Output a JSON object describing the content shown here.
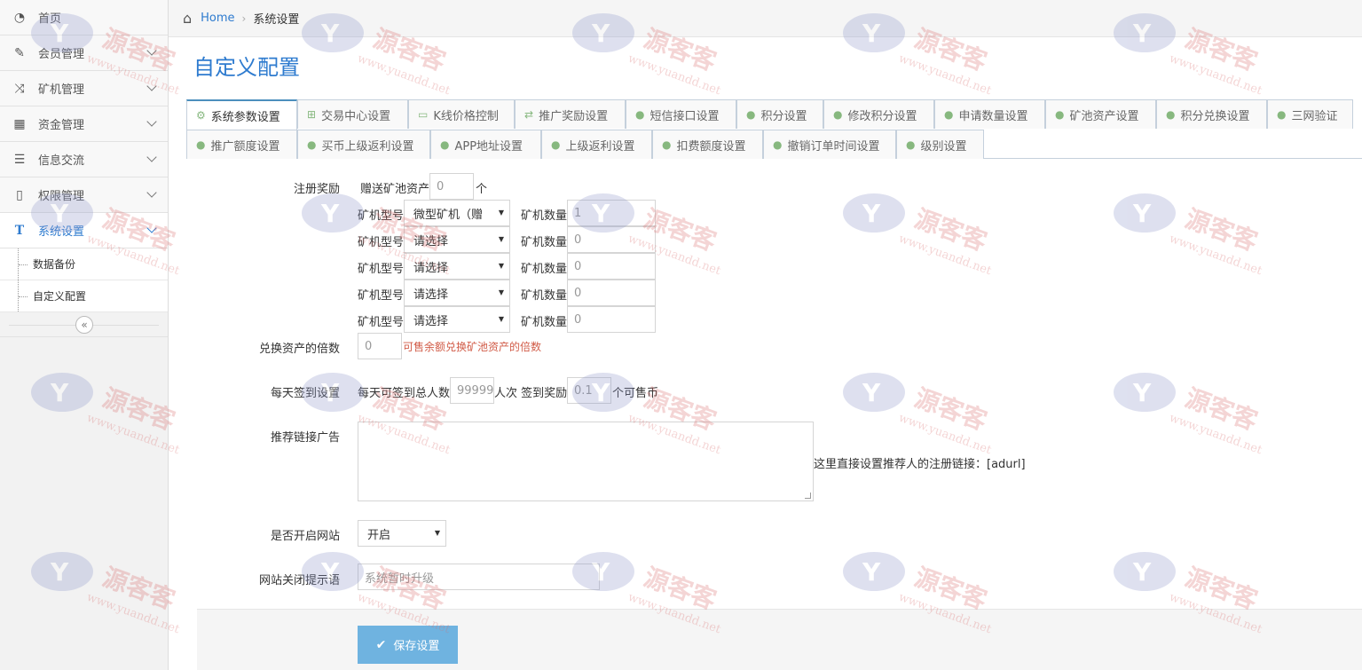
{
  "sidebar": {
    "items": [
      {
        "label": "首页"
      },
      {
        "label": "会员管理"
      },
      {
        "label": "矿机管理"
      },
      {
        "label": "资金管理"
      },
      {
        "label": "信息交流"
      },
      {
        "label": "权限管理"
      },
      {
        "label": "系统设置"
      }
    ],
    "sub_items": [
      {
        "label": "数据备份"
      },
      {
        "label": "自定义配置"
      }
    ],
    "collapse_glyph": "«"
  },
  "breadcrumb": {
    "home": "Home",
    "current": "系统设置"
  },
  "page_title": "自定义配置",
  "tabs": {
    "row1": [
      {
        "label": "系统参数设置"
      },
      {
        "label": "交易中心设置"
      },
      {
        "label": "K线价格控制"
      },
      {
        "label": "推广奖励设置"
      },
      {
        "label": "短信接口设置"
      },
      {
        "label": "积分设置"
      },
      {
        "label": "修改积分设置"
      },
      {
        "label": "申请数量设置"
      },
      {
        "label": "矿池资产设置"
      },
      {
        "label": "积分兑换设置"
      },
      {
        "label": "三网验证"
      }
    ],
    "row2": [
      {
        "label": "推广额度设置"
      },
      {
        "label": "买币上级返利设置"
      },
      {
        "label": "APP地址设置"
      },
      {
        "label": "上级返利设置"
      },
      {
        "label": "扣费额度设置"
      },
      {
        "label": "撤销订单时间设置"
      },
      {
        "label": "级别设置"
      }
    ]
  },
  "form": {
    "register_reward": {
      "label": "注册奖励",
      "gift_prefix": "赠送矿池资产",
      "gift_value": "0",
      "gift_unit": "个",
      "model_label": "矿机型号",
      "qty_label": "矿机数量",
      "rows": [
        {
          "model": "微型矿机（赠",
          "qty": "1"
        },
        {
          "model": "请选择",
          "qty": "0"
        },
        {
          "model": "请选择",
          "qty": "0"
        },
        {
          "model": "请选择",
          "qty": "0"
        },
        {
          "model": "请选择",
          "qty": "0"
        }
      ]
    },
    "exchange_multiple": {
      "label": "兑换资产的倍数",
      "value": "0",
      "hint": "可售余额兑换矿池资产的倍数"
    },
    "daily_signin": {
      "label": "每天签到设置",
      "prefix": "每天可签到总人数",
      "count": "99999",
      "mid": "人次 签到奖励",
      "reward": "0.1",
      "suffix": "个可售币"
    },
    "ad": {
      "label": "推荐链接广告",
      "note": "这里直接设置推荐人的注册链接：[adurl]"
    },
    "site_open": {
      "label": "是否开启网站",
      "value": "开启"
    },
    "close_msg": {
      "label": "网站关闭提示语",
      "placeholder": "系统暂时升级"
    }
  },
  "save_button": {
    "label": "保存设置"
  },
  "watermark": {
    "text": "源客客",
    "url": "www.yuandd.net"
  }
}
